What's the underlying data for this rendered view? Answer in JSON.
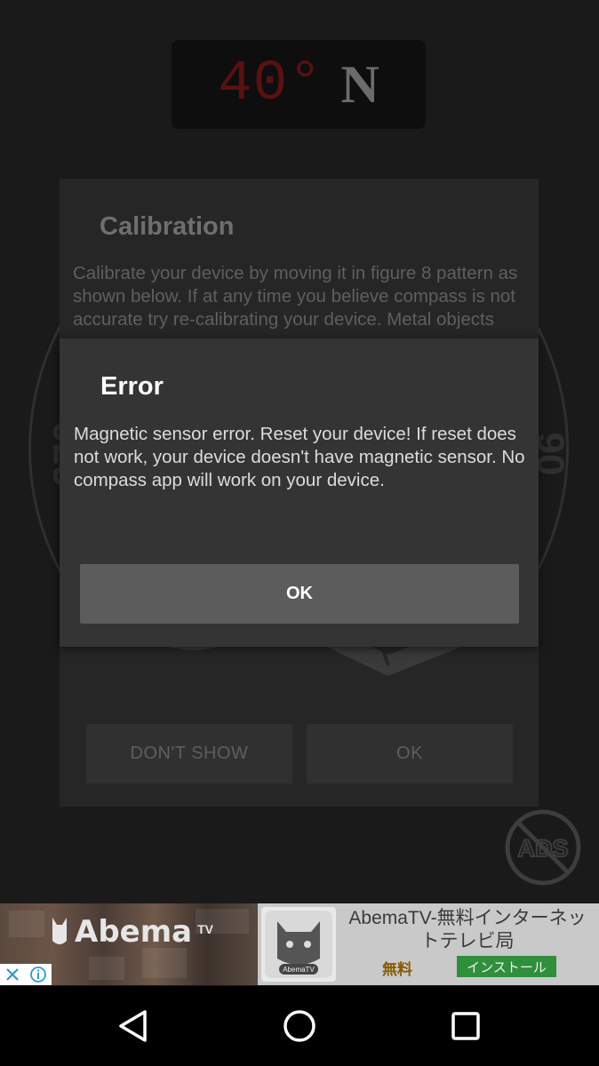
{
  "compass": {
    "heading_degrees": "40°",
    "heading_direction": "N",
    "ring_label_west": "270",
    "ring_label_east": "90"
  },
  "calibration_dialog": {
    "title": "Calibration",
    "body": "Calibrate your device by moving it in figure 8 pattern as shown below. If at any time you believe compass is not accurate try re-calibrating your device. Metal objects and magnetic",
    "dont_show_label": "DON'T SHOW",
    "ok_label": "OK"
  },
  "error_dialog": {
    "title": "Error",
    "message": "Magnetic sensor error. Reset your device! If reset does not work, your device doesn't have magnetic sensor. No compass app will work on your device.",
    "ok_label": "OK"
  },
  "no_ads": {
    "icon": "no-ads-icon",
    "label": "ADS"
  },
  "ad_banner": {
    "brand": "Abema",
    "brand_suffix": "TV",
    "app_icon_label": "AbemaTV",
    "headline": "AbemaTV-無料インターネットテレビ局",
    "price": "無料",
    "install_label": "インストール"
  },
  "nav_bar": {
    "back_icon": "back-triangle-icon",
    "home_icon": "home-circle-icon",
    "recents_icon": "recents-square-icon"
  },
  "colors": {
    "dialog_bg": "#343434",
    "button_bg": "#5c5c5c",
    "heading_red": "#5a1111"
  }
}
